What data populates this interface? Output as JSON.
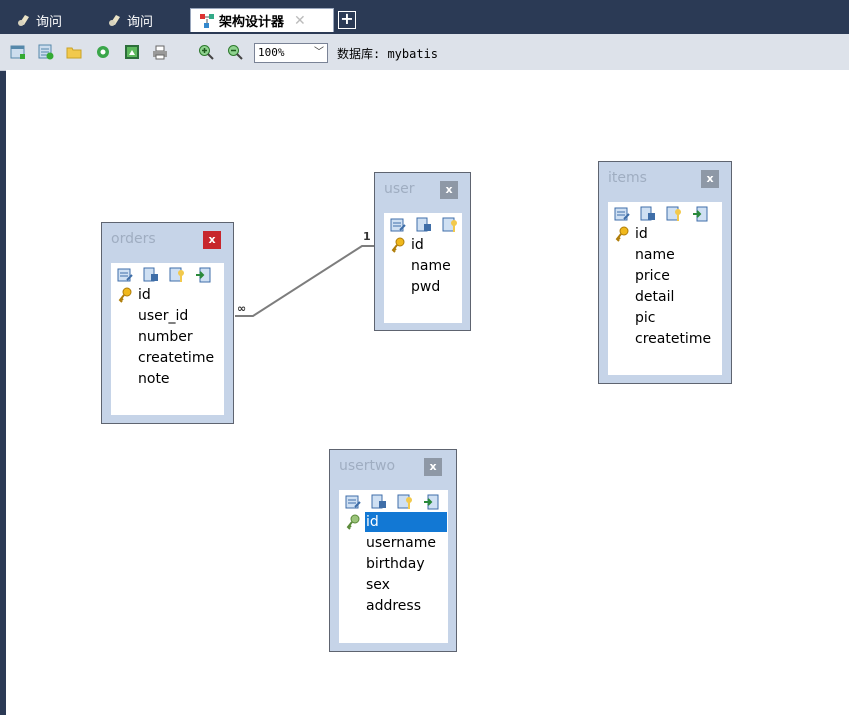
{
  "tabs": [
    {
      "label": "询问",
      "active": false
    },
    {
      "label": "询问",
      "active": false
    },
    {
      "label": "架构设计器",
      "active": true
    }
  ],
  "toolbar": {
    "icons": [
      "new-table-icon",
      "add-table-icon",
      "open-folder-icon",
      "refresh-icon",
      "export-image-icon",
      "print-icon",
      "zoom-in-icon",
      "zoom-out-icon"
    ],
    "zoom": "100%",
    "database": "数据库: mybatis"
  },
  "tables": {
    "orders": {
      "name": "orders",
      "fields": [
        "id",
        "user_id",
        "number",
        "createtime",
        "note"
      ]
    },
    "user": {
      "name": "user",
      "fields": [
        "id",
        "name",
        "pwd"
      ]
    },
    "items": {
      "name": "items",
      "fields": [
        "id",
        "name",
        "price",
        "detail",
        "pic",
        "createtime"
      ]
    },
    "usertwo": {
      "name": "usertwo",
      "fields": [
        "id",
        "username",
        "birthday",
        "sex",
        "address"
      ]
    }
  },
  "relation": {
    "from": "orders",
    "to": "user",
    "from_card": "∞",
    "to_card": "1"
  },
  "colors": {
    "header": "#2b3a55",
    "toolbar": "#dde2ea",
    "table_bg": "#c6d4e8",
    "close_active": "#c7262c",
    "selection": "#1278d4"
  }
}
